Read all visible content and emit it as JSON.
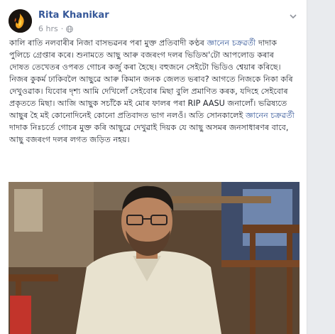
{
  "post": {
    "author": "Rita Khanikar",
    "time": "6 hrs",
    "text_1": "কালি ৰাতি নলবাৰীৰ নিজা বাসভৱনৰ পৰা মুক্ত প্ৰতিবাদী কণ্ঠৰ ",
    "link_1": "জ্ঞানেন চক্ৰৱৰ্তী",
    "text_2": " দাদাক পুলিচে গ্ৰেপ্তাৰ কৰে। শুনামতে আছু আৰু বজৰংগ দলৰ ভিডিঅ'টো আপলোড কৰাৰ দোষত তেখেতৰ ওপৰত গোচৰ কৰ্জু কৰা হৈছে। বহুজনে সেইটো ভিডিও শ্বেয়াৰ কৰিছে। নিজৰ কুকৰ্ম ঢাকিবলৈ আছুৱে আৰু কিমান জনক জেলত ভৰাব? আগতে নিজকে নিকা কৰি দেখুওৱাক। যিবোৰ দৃশ্য আমি দেখিলোঁ সেইবোৰ মিছা বুলি প্ৰমাণিত কৰক, যদিহে সেইবোৰ প্ৰকৃততে মিছা। আজি আছুক সচাঁকৈ মই মোৰ ফালৰ পৰা RIP AASU জনালোঁ। ভৱিষ্যতে আছুৰ হৈ মই কোনোদিনেই কোনো প্ৰতিবাদত ভাগ নলওঁ। অতি সোনকালেই ",
    "link_2": "জ্ঞানেন চক্ৰৱৰ্তী",
    "text_3": " দাদাক নিঃচৰ্তে গোচৰ মুক্ত কৰি আছুৱে দেখুৱাই দিয়ক যে আছু অসমৰ জনসাধাৰণৰ বাবে, আছু বজৰংগ দলৰ লগত জড়িত নহয়।"
  },
  "icons": {
    "avatar": "fire-logo-avatar",
    "privacy": "globe-icon",
    "menu": "chevron-down-icon"
  },
  "colors": {
    "link": "#365899",
    "meta": "#90949c",
    "text": "#1d2129",
    "background": "#e9ebee"
  }
}
